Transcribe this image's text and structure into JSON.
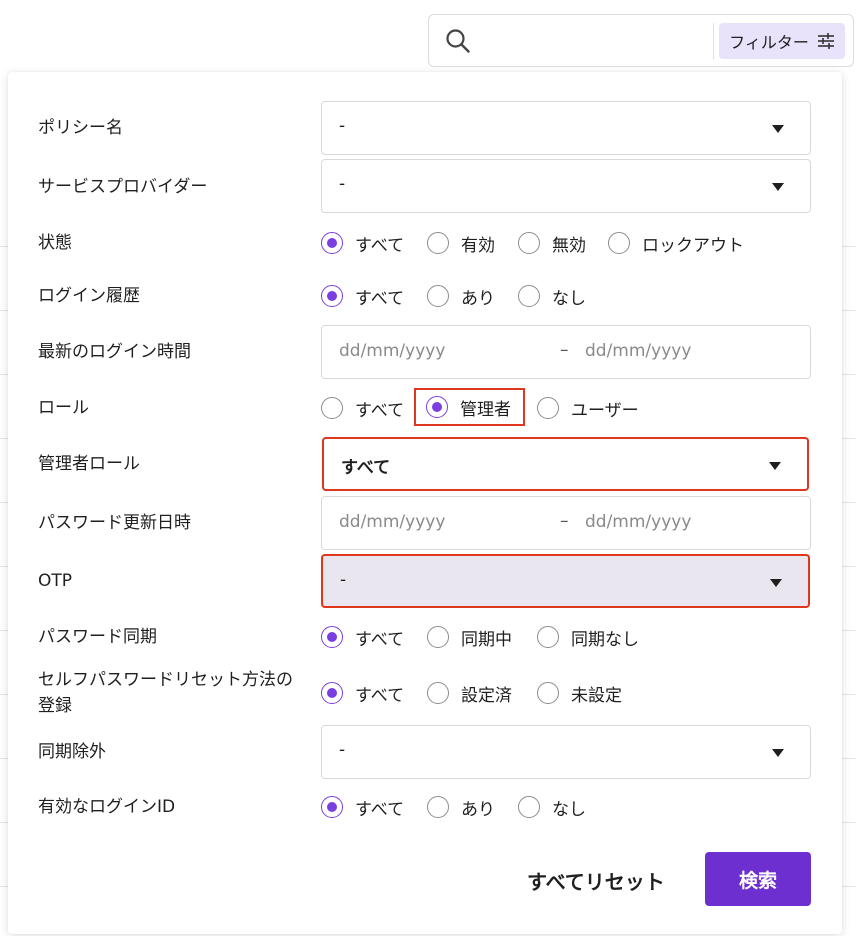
{
  "search": {
    "placeholder": "",
    "filter_label": "フィルター"
  },
  "accent_color": "#7b3fe0",
  "highlight_color": "#e0361e",
  "filters": {
    "policy_name": {
      "label": "ポリシー名",
      "value": "-"
    },
    "service_provider": {
      "label": "サービスプロバイダー",
      "value": "-"
    },
    "status": {
      "label": "状態",
      "options": [
        "すべて",
        "有効",
        "無効",
        "ロックアウト"
      ],
      "selected": "すべて"
    },
    "login_history": {
      "label": "ログイン履歴",
      "options": [
        "すべて",
        "あり",
        "なし"
      ],
      "selected": "すべて"
    },
    "last_login": {
      "label": "最新のログイン時間",
      "from_placeholder": "dd/mm/yyyy",
      "separator": "–",
      "to_placeholder": "dd/mm/yyyy"
    },
    "role": {
      "label": "ロール",
      "options": [
        "すべて",
        "管理者",
        "ユーザー"
      ],
      "selected": "管理者"
    },
    "admin_role": {
      "label": "管理者ロール",
      "value": "すべて"
    },
    "password_updated": {
      "label": "パスワード更新日時",
      "from_placeholder": "dd/mm/yyyy",
      "separator": "–",
      "to_placeholder": "dd/mm/yyyy"
    },
    "otp": {
      "label": "OTP",
      "value": "-"
    },
    "password_sync": {
      "label": "パスワード同期",
      "options": [
        "すべて",
        "同期中",
        "同期なし"
      ],
      "selected": "すべて"
    },
    "self_reset": {
      "label": "セルフパスワードリセット方法の登録",
      "options": [
        "すべて",
        "設定済",
        "未設定"
      ],
      "selected": "すべて"
    },
    "sync_exclusion": {
      "label": "同期除外",
      "value": "-"
    },
    "valid_login_id": {
      "label": "有効なログインID",
      "options": [
        "すべて",
        "あり",
        "なし"
      ],
      "selected": "すべて"
    }
  },
  "actions": {
    "reset_label": "すべてリセット",
    "search_label": "検索"
  }
}
